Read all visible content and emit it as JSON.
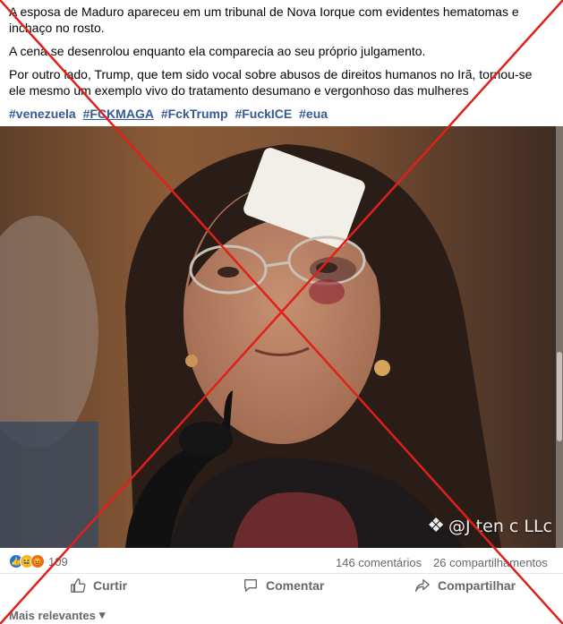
{
  "post": {
    "paragraphs": [
      "A esposa de Maduro apareceu em um tribunal de Nova Iorque com evidentes hematomas e inchaço no rosto.",
      "A cena se desenrolou enquanto ela comparecia ao seu próprio julgamento.",
      "Por outro lado, Trump, que tem sido vocal sobre abusos de direitos humanos no Irã, tornou-se ele mesmo um exemplo vivo do tratamento desumano e vergonhoso das mulheres"
    ],
    "hashtags": [
      "#venezuela",
      "#FCKMAGA",
      "#FckTrump",
      "#FuckICE",
      "#eua"
    ]
  },
  "photo": {
    "watermark_text": "@J ten c LLc",
    "watermark_logo": "diamond-logo"
  },
  "stats": {
    "reaction_count": "109",
    "comments": "146 comentários",
    "shares": "26 compartilhamentos"
  },
  "actions": {
    "like_label": "Curtir",
    "comment_label": "Comentar",
    "share_label": "Compartilhar"
  },
  "sort": {
    "label": "Mais relevantes"
  },
  "icons": {
    "like": "thumbs-up-icon",
    "comment": "speech-bubble-icon",
    "share": "share-arrow-icon",
    "sort": "caret-down-icon"
  },
  "colors": {
    "hashtag": "#385898",
    "like_reaction": "#1b74e4",
    "haha_reaction": "#f7b125",
    "angry_reaction": "#e9710f",
    "false_cross": "#e0201b"
  }
}
